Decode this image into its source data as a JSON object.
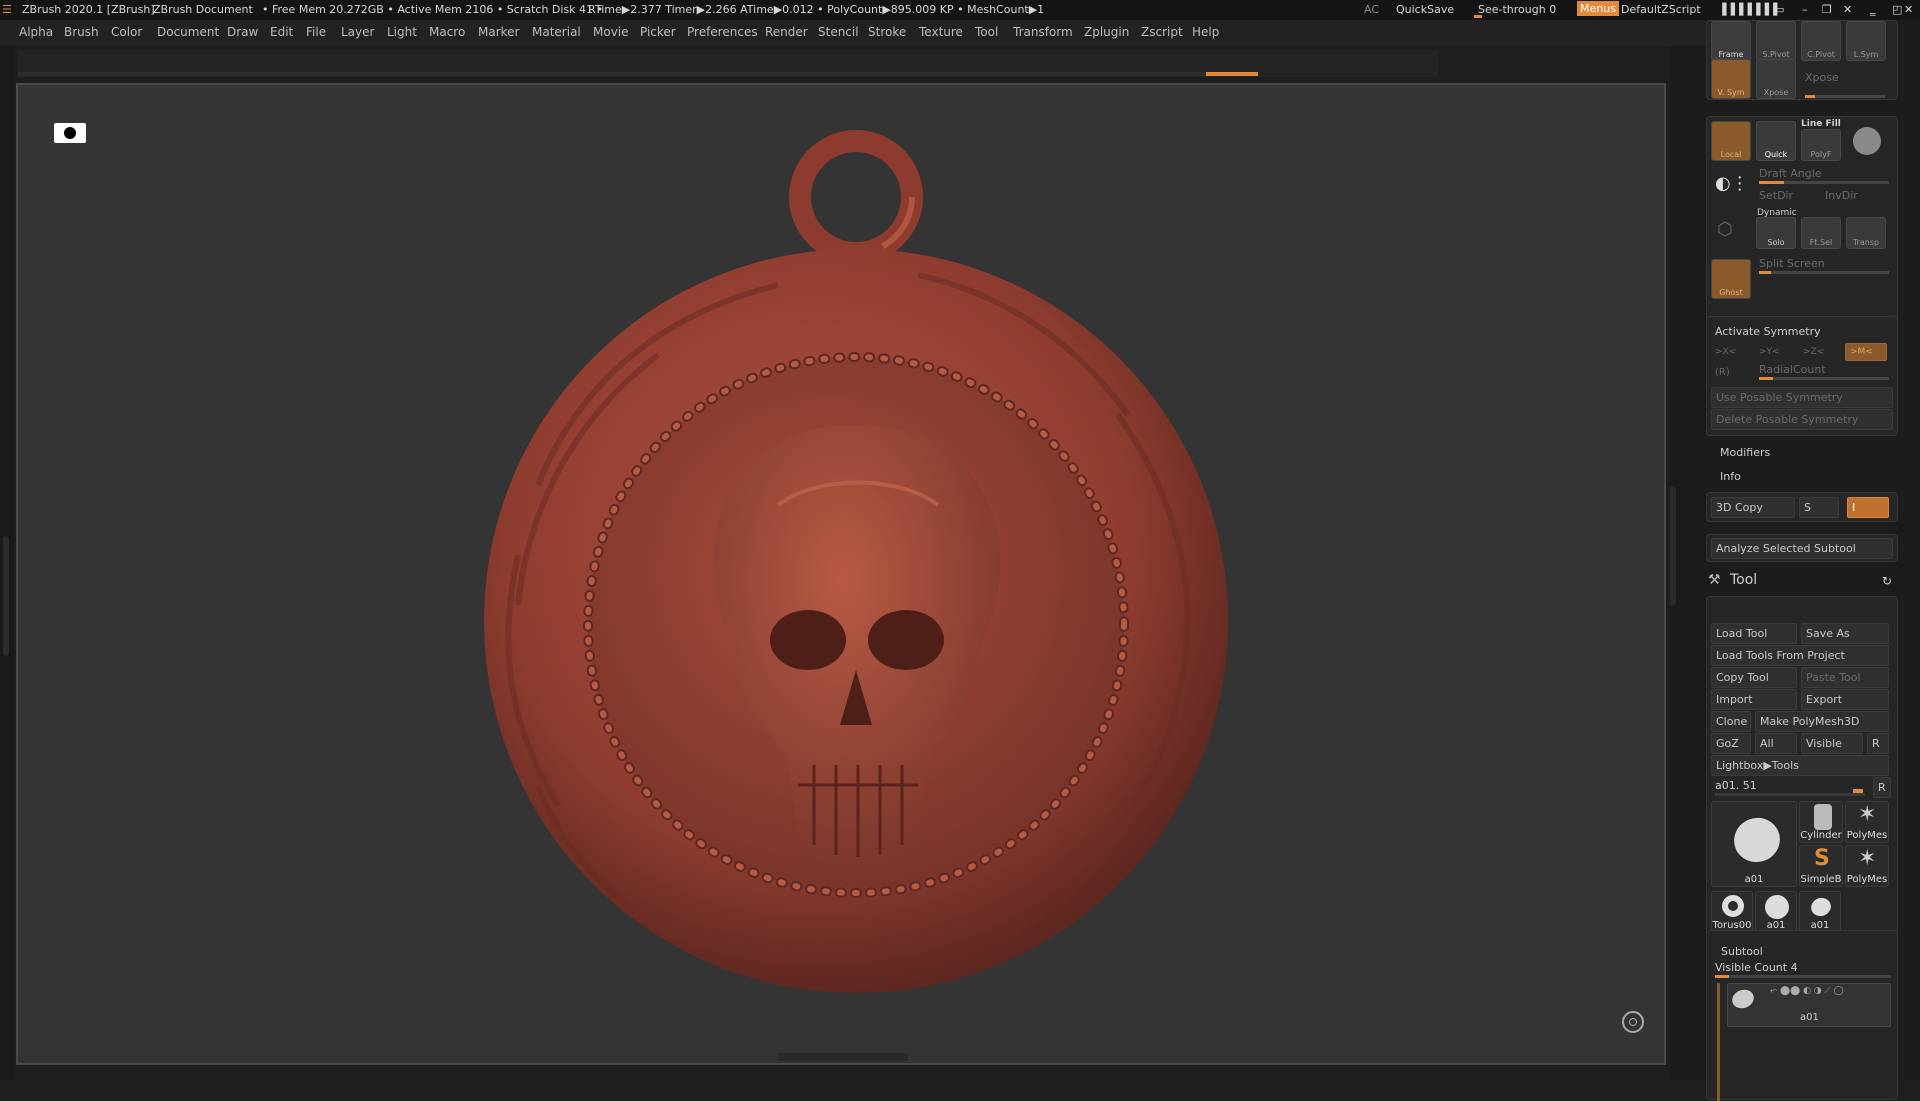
{
  "titlebar": {
    "app": "ZBrush 2020.1 [ZBrush]",
    "doc": "ZBrush Document",
    "free_mem": "• Free Mem 20.272GB • Active Mem 2106 • Scratch Disk 41 •",
    "rtime": "RTime▶2.377 Timer▶2.266 ATime▶0.012 • PolyCount▶895.009 KP • MeshCount▶1",
    "ac": "AC",
    "quicksave": "QuickSave",
    "seethrough": "See-through  0",
    "menus": "Menus",
    "script": "DefaultZScript"
  },
  "menu": [
    "Alpha",
    "Brush",
    "Color",
    "Document",
    "Draw",
    "Edit",
    "File",
    "Layer",
    "Light",
    "Macro",
    "Marker",
    "Material",
    "Movie",
    "Picker",
    "Preferences",
    "Render",
    "Stencil",
    "Stroke",
    "Texture",
    "Tool",
    "Transform",
    "Zplugin",
    "Zscript",
    "Help"
  ],
  "colors": {
    "accent": "#e08a3a",
    "clay": "#9c4236"
  },
  "viewport": {
    "icon": "record-icon",
    "corner_icon": "target-icon"
  },
  "panel": {
    "frame": "Frame",
    "spivot": "S.Pivot",
    "cpivot": "C.Pivot",
    "lsym": "L.Sym",
    "vsym": "V. Sym",
    "xpose_btn": "Xpose",
    "xpose": "Xpose",
    "local": "Local",
    "quick": "Quick",
    "linefill": "Line Fill",
    "polyf": "PolyF",
    "draft_angle": "Draft Angle",
    "setdir": "SetDir",
    "invdir": "InvDir",
    "dynamic": "Dynamic",
    "solo": "Solo",
    "ftsel": "Ft.Sel",
    "transp": "Transp",
    "ghost": "Ghost",
    "split_screen": "Split Screen",
    "activate_symmetry": "Activate Symmetry",
    "x": ">X<",
    "y": ">Y<",
    "z": ">Z<",
    "m": ">M<",
    "r": "(R)",
    "radialcount": "RadialCount",
    "use_posable": "Use Posable Symmetry",
    "delete_posable": "Delete Posable Symmetry",
    "modifiers": "Modifiers",
    "info": "Info",
    "copy3d": "3D Copy",
    "s": "S",
    "i": "I",
    "analyze": "Analyze Selected Subtool",
    "tool_title": "Tool",
    "load_tool": "Load Tool",
    "save_as": "Save As",
    "load_from_project": "Load Tools From Project",
    "copy_tool": "Copy Tool",
    "paste_tool": "Paste Tool",
    "import": "Import",
    "export": "Export",
    "clone": "Clone",
    "make_polymesh": "Make PolyMesh3D",
    "goz": "GoZ",
    "all": "All",
    "visible": "Visible",
    "r_btn": "R",
    "lightbox_tools": "Lightbox▶Tools",
    "current_tool": "a01. 51",
    "r2": "R",
    "thumbs": {
      "main": "a01",
      "cylinder": "Cylinder",
      "polymesh1": "PolyMes",
      "simpleb": "SimpleB",
      "polymesh2": "PolyMes",
      "torus": "Torus00",
      "a01b": "a01",
      "a01c": "a01"
    },
    "subtool": "Subtool",
    "visible_count": "Visible Count 4",
    "subtool_item": "a01"
  }
}
